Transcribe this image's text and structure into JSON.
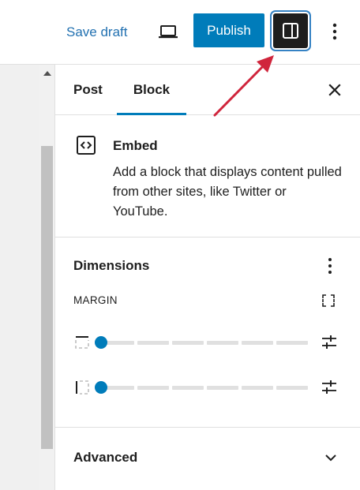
{
  "header": {
    "save_draft_label": "Save draft",
    "publish_label": "Publish"
  },
  "icons": {
    "device": "laptop-icon",
    "settings": "sidebar-toggle-icon",
    "more": "vertical-ellipsis-icon",
    "close": "close-icon",
    "embed": "embed-icon",
    "margin_link": "link-sides-icon",
    "side_top": "side-top-icon",
    "side_left": "side-left-icon",
    "adjust": "sliders-icon",
    "chevron": "chevron-down-icon"
  },
  "sidebar": {
    "tabs": [
      {
        "label": "Post",
        "active": false
      },
      {
        "label": "Block",
        "active": true
      }
    ],
    "block": {
      "title": "Embed",
      "description": "Add a block that displays content pulled from other sites, like Twitter or YouTube."
    },
    "dimensions": {
      "title": "Dimensions",
      "margin_label": "MARGIN",
      "sliders": [
        {
          "side": "top",
          "value": 0
        },
        {
          "side": "left",
          "value": 0
        }
      ]
    },
    "advanced": {
      "title": "Advanced"
    }
  },
  "colors": {
    "accent": "#007cba",
    "link": "#2271b1",
    "annotation_arrow": "#d0253c",
    "dark": "#1e1e1e"
  }
}
